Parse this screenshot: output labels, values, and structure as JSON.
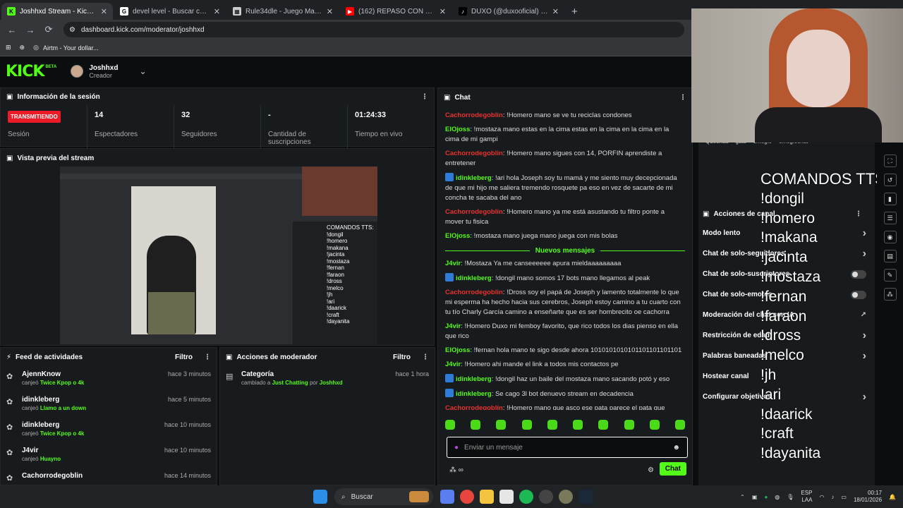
{
  "browser": {
    "tabs": [
      {
        "title": "Joshhxd Stream - Kick Dashboa",
        "color": "#53fc18",
        "glyph": "K",
        "active": true
      },
      {
        "title": "devel level - Buscar con Google",
        "color": "#ffffff",
        "glyph": "G",
        "active": false
      },
      {
        "title": "Rule34dle - Juego Mayor o Me",
        "color": "#cccccc",
        "glyph": "▦",
        "active": false
      },
      {
        "title": "(162) REPASO CON MÚSICA - ",
        "color": "#ff0000",
        "glyph": "▶",
        "active": false
      },
      {
        "title": "DUXO (@duxooficial) | TikTok",
        "color": "#000000",
        "glyph": "♪",
        "active": false
      }
    ],
    "url": "dashboard.kick.com/moderator/joshhxd",
    "bookmark": "Airtm - Your dollar..."
  },
  "kick": {
    "logo": "KICK",
    "beta": "BETA",
    "username": "Joshhxd",
    "role": "Creador"
  },
  "session": {
    "title": "Información de la sesión",
    "live_label": "TRANSMITIENDO",
    "status_label": "Sesión",
    "stats": [
      {
        "value": "14",
        "label": "Espectadores"
      },
      {
        "value": "32",
        "label": "Seguidores"
      },
      {
        "value": "-",
        "label": "Cantidad de suscripciones"
      },
      {
        "value": "01:24:33",
        "label": "Tiempo en vivo"
      }
    ]
  },
  "preview": {
    "title": "Vista previa del stream",
    "inner_commands": [
      "COMANDOS TTS:",
      "!dongil",
      "!homero",
      "!makana",
      "!jacinta",
      "!mostaza",
      "!fernan",
      "!faraon",
      "!dross",
      "!melco",
      "!jh",
      "!ari",
      "!daarick",
      "!craft",
      "!dayanita"
    ]
  },
  "feed": {
    "title": "Feed de actividades",
    "filter": "Filtro",
    "items": [
      {
        "name": "AjennKnow",
        "action": "canjeó",
        "reward": "Twice Kpop o 4k",
        "time": "hace 3 minutos"
      },
      {
        "name": "idinkleberg",
        "action": "canjeó",
        "reward": "Llamo a un down",
        "time": "hace 5 minutos"
      },
      {
        "name": "idinkleberg",
        "action": "canjeó",
        "reward": "Twice Kpop o 4k",
        "time": "hace 10 minutos"
      },
      {
        "name": "J4vir",
        "action": "canjeó",
        "reward": "Huayno",
        "time": "hace 10 minutos"
      },
      {
        "name": "Cachorrodegoblin",
        "action": "",
        "reward": "",
        "time": "hace 14 minutos"
      }
    ]
  },
  "modactions": {
    "title": "Acciones de moderador",
    "filter": "Filtro",
    "item": {
      "title": "Categoría",
      "pre": "cambiado a",
      "category": "Just Chatting",
      "by": "por",
      "user": "Joshhxd",
      "time": "hace 1 hora"
    }
  },
  "chat": {
    "title": "Chat",
    "new_messages_label": "Nuevos mensajes",
    "input_placeholder": "Enviar un mensaje",
    "send_label": "Chat",
    "messages_before": [
      {
        "user": "Cachorrodegoblin",
        "color": "#e8322d",
        "badge": false,
        "text": "!Homero mano se ve tu reciclas condones"
      },
      {
        "user": "ElOjoss",
        "color": "#53fc18",
        "badge": false,
        "text": "!mostaza mano estas en la cima estas en la cima en la cima en la cima de mi gampi"
      },
      {
        "user": "Cachorrodegoblin",
        "color": "#e8322d",
        "badge": false,
        "text": "!Homero mano sigues con 14, PORFIN aprendiste a entretener"
      },
      {
        "user": "idinkleberg",
        "color": "#53fc18",
        "badge": true,
        "text": "!ari hola Joseph soy tu mamá y me siento muy decepcionada de que mi hijo me saliera tremendo rosquete pa eso en vez de sacarte de mi concha te sacaba del ano"
      },
      {
        "user": "Cachorrodegoblin",
        "color": "#e8322d",
        "badge": false,
        "text": "!Homero mano ya me está asustando tu filtro ponte a mover tu fisica"
      },
      {
        "user": "ElOjoss",
        "color": "#53fc18",
        "badge": false,
        "text": "!mostaza mano juega mano juega con mis bolas"
      }
    ],
    "messages_after": [
      {
        "user": "J4vir",
        "color": "#53fc18",
        "badge": false,
        "text": "!Mostaza Ya me canseeeeee apura mieldaaaaaaaaa"
      },
      {
        "user": "idinkleberg",
        "color": "#53fc18",
        "badge": true,
        "text": "!dongil mano somos 17 bots mano llegamos al peak"
      },
      {
        "user": "Cachorrodegoblin",
        "color": "#e8322d",
        "badge": false,
        "text": "!Dross soy el papá de Joseph y lamento totalmente lo que mi esperma ha hecho hacia sus cerebros, Joseph estoy camino a tu cuarto con tu tío Charly García camino a enseñarte que es ser hombrecito oe cachorra"
      },
      {
        "user": "J4vir",
        "color": "#53fc18",
        "badge": false,
        "text": "!Homero Duxo mi femboy favorito, que rico todos los dias pienso en ella que rico"
      },
      {
        "user": "ElOjoss",
        "color": "#53fc18",
        "badge": false,
        "text": "!fernan hola mano te sigo desde ahora 1010101010101101101101101"
      },
      {
        "user": "J4vir",
        "color": "#53fc18",
        "badge": false,
        "text": "!Homero ahi mande el link a todos mis contactos pe"
      },
      {
        "user": "idinkleberg",
        "color": "#53fc18",
        "badge": true,
        "text": "!dongil haz un baile del mostaza mano sacando potó y eso"
      },
      {
        "user": "idinkleberg",
        "color": "#53fc18",
        "badge": true,
        "text": "Se cago 3l bot denuevo stream en decadencia"
      },
      {
        "user": "Cachorrodegoblin",
        "color": "#e8322d",
        "badge": false,
        "text": "!Homero mano que asco ese pata parece el pata que controla la máquina de mi viejo acá en su cantera de Andahuaylas tierra querida"
      }
    ]
  },
  "camera_overlay": {
    "tabs": [
      "Quechua",
      "gaia",
      "omegle",
      "omeglechat"
    ]
  },
  "channel_actions": {
    "title": "Acciones de canal",
    "items": [
      {
        "label": "Modo lento",
        "control": "chevron"
      },
      {
        "label": "Chat de solo-seguidores",
        "control": "chevron"
      },
      {
        "label": "Chat de solo-suscriptores",
        "control": "toggle"
      },
      {
        "label": "Chat de solo-emotes",
        "control": "toggle"
      },
      {
        "label": "Moderación del chat con IA",
        "control": "external"
      },
      {
        "label": "Restricción de edad",
        "control": "chevron"
      },
      {
        "label": "Palabras baneadas",
        "control": "chevron"
      },
      {
        "label": "Hostear canal",
        "control": "none"
      },
      {
        "label": "Configurar objetivos",
        "control": "chevron"
      }
    ]
  },
  "tts": {
    "heading": "COMANDOS TTS:",
    "commands": [
      "!dongil",
      "!homero",
      "!makana",
      "!jacinta",
      "!mostaza",
      "!fernan",
      "!faraon",
      "!dross",
      "!melco",
      "!jh",
      "!ari",
      "!daarick",
      "!craft",
      "!dayanita"
    ]
  },
  "taskbar": {
    "search": "Buscar",
    "lang": "ESP",
    "lang2": "LAA",
    "time": "00:17",
    "date": "18/01/2026"
  }
}
